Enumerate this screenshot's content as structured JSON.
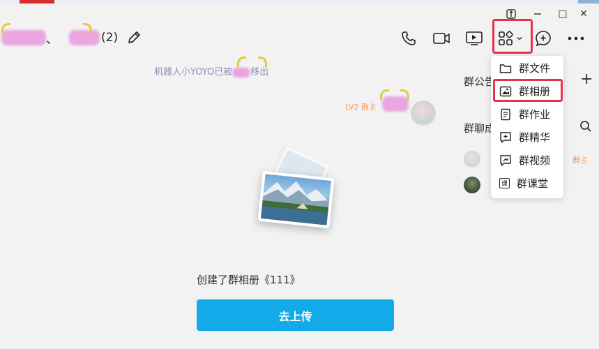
{
  "title": {
    "separator": "、",
    "member_count": "(2)"
  },
  "window_controls": {
    "restore_glyph": "□",
    "close_glyph": "✕"
  },
  "chat": {
    "system_prefix": "机器人小YOYO已被",
    "system_suffix": "移出",
    "sender_level": "LV2 群主",
    "album_created": "创建了群相册《111》",
    "upload_label": "去上传"
  },
  "side_panel": {
    "announce_label": "群公告",
    "members_label": "群聊成员",
    "owner_tag": "群主"
  },
  "apps_menu": {
    "items": [
      {
        "label": "群文件",
        "icon": "folder-icon"
      },
      {
        "label": "群相册",
        "icon": "album-icon"
      },
      {
        "label": "群作业",
        "icon": "homework-icon"
      },
      {
        "label": "群精华",
        "icon": "essence-icon"
      },
      {
        "label": "群视频",
        "icon": "video-icon"
      },
      {
        "label": "群课堂",
        "icon": "classroom-icon"
      }
    ],
    "classroom_badge": "课"
  },
  "colors": {
    "upload_button": "#12aae8",
    "highlight_border": "#e3334f",
    "system_text": "#8b91b6",
    "owner_tag": "#f29a5e"
  }
}
